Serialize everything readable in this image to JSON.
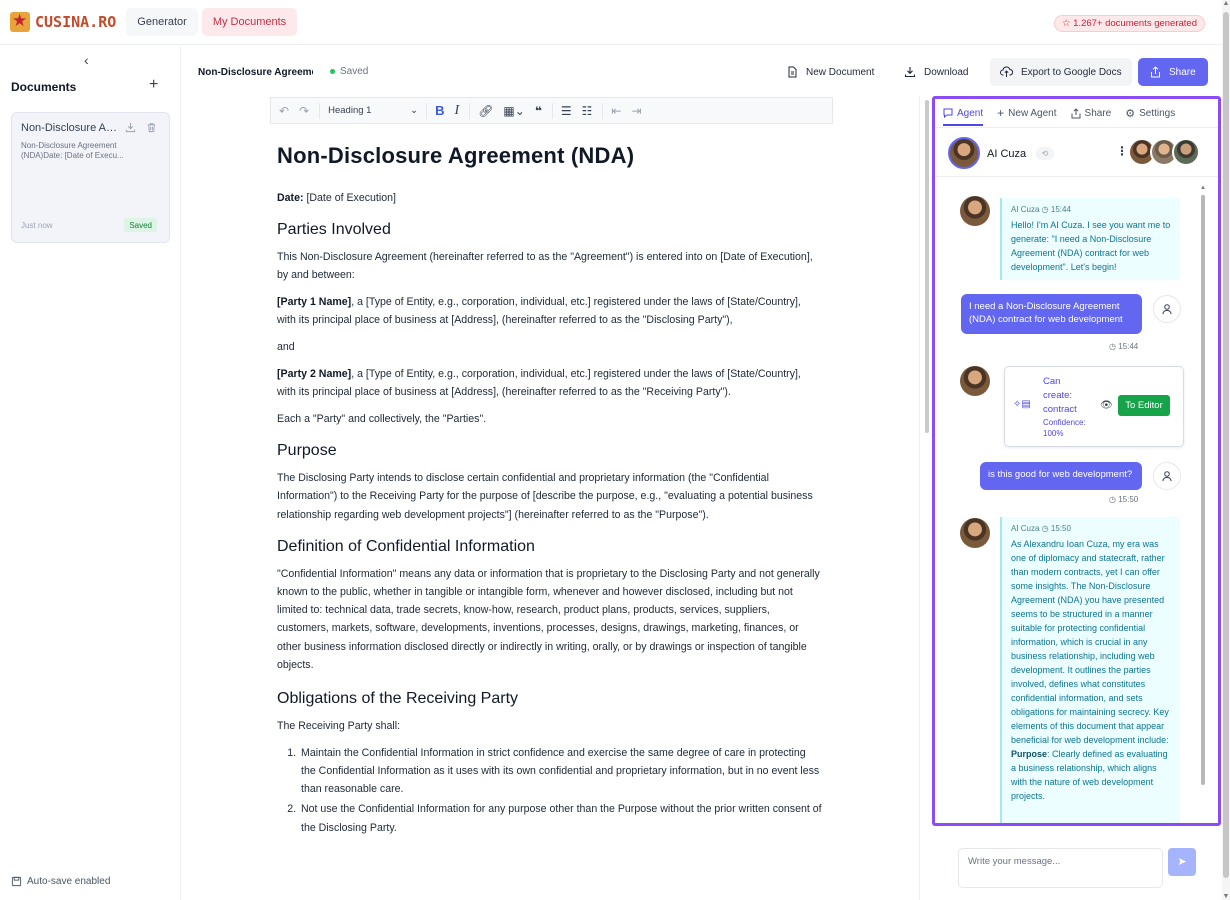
{
  "app": {
    "logo_text": "CUSINA.RO",
    "nav": [
      {
        "label": "Generator"
      },
      {
        "label": "My Documents"
      }
    ],
    "doc_count_badge": "☆ 1.267+ documents generated",
    "accent_color": "#6366f1",
    "agent_border_color": "#8b4cf7"
  },
  "sidebar": {
    "collapse_icon": "chevron-left-icon",
    "title": "Documents",
    "add_icon": "plus-icon",
    "documents": [
      {
        "title": "Non-Disclosure Agreement (NDA)",
        "subtitle": "Non-Disclosure Agreement (NDA)Date: [Date of Execu...",
        "time": "Just now",
        "status": "Saved"
      }
    ],
    "autosave_label": "Auto-save enabled"
  },
  "doc_toolbar": {
    "document_name": "Non-Disclosure Agreement (NDA)",
    "status": "Saved",
    "new_document": "New Document",
    "download": "Download",
    "export": "Export to Google Docs",
    "share": "Share"
  },
  "editor_toolbar": {
    "heading_select": "Heading 1"
  },
  "document": {
    "title": "Non-Disclosure Agreement (NDA)",
    "date_label": "Date:",
    "date_value": " [Date of Execution]",
    "section1": "Parties Involved",
    "p1": "This Non-Disclosure Agreement (hereinafter referred to as the \"Agreement\") is entered into on [Date of Execution], by and between:",
    "party1_name": "[Party 1 Name]",
    "party1_rest": ", a [Type of Entity, e.g., corporation, individual, etc.] registered under the laws of [State/Country], with its principal place of business at [Address], (hereinafter referred to as the \"Disclosing Party\"),",
    "and": "and",
    "party2_name": "[Party 2 Name]",
    "party2_rest": ", a [Type of Entity, e.g., corporation, individual, etc.] registered under the laws of [State/Country], with its principal place of business at [Address], (hereinafter referred to as the \"Receiving Party\").",
    "parties_note": "Each a \"Party\" and collectively, the \"Parties\".",
    "section2": "Purpose",
    "purpose": "The Disclosing Party intends to disclose certain confidential and proprietary information (the \"Confidential Information\") to the Receiving Party for the purpose of [describe the purpose, e.g., \"evaluating a potential business relationship regarding web development projects\"] (hereinafter referred to as the \"Purpose\").",
    "section3": "Definition of Confidential Information",
    "definition": "\"Confidential Information\" means any data or information that is proprietary to the Disclosing Party and not generally known to the public, whether in tangible or intangible form, whenever and however disclosed, including but not limited to: technical data, trade secrets, know-how, research, product plans, products, services, suppliers, customers, markets, software, developments, inventions, processes, designs, drawings, marketing, finances, or other business information disclosed directly or indirectly in writing, orally, or by drawings or inspection of tangible objects.",
    "section4": "Obligations of the Receiving Party",
    "obligations_intro": "The Receiving Party shall:",
    "obligations": [
      "Maintain the Confidential Information in strict confidence and exercise the same degree of care in protecting the Confidential Information as it uses with its own confidential and proprietary information, but in no event less than reasonable care.",
      "Not use the Confidential Information for any purpose other than the Purpose without the prior written consent of the Disclosing Party."
    ]
  },
  "agent": {
    "tabs": [
      {
        "label": "Agent",
        "icon": "chat-icon"
      },
      {
        "label": "New Agent",
        "icon": "plus-icon"
      },
      {
        "label": "Share",
        "icon": "share-icon"
      },
      {
        "label": "Settings",
        "icon": "gear-icon"
      }
    ],
    "name": "AI Cuza",
    "history_icon": "history-icon",
    "messages": {
      "m1_meta": "AI Cuza ◷ 15:44",
      "m1_text": "Hello! I'm AI Cuza. I see you want me to generate: \"I need a Non-Disclosure Agreement (NDA) contract for web development\". Let's begin!",
      "u1_text": "I need a Non-Disclosure Agreement (NDA) contract for web development",
      "u1_time": "◷ 15:44",
      "card_line1": "Can",
      "card_line2": "create:",
      "card_line3": "contract",
      "card_confidence": "Confidence: 100%",
      "card_button": "To Editor",
      "u2_text": "is this good for web development?",
      "u2_time": "◷ 15:50",
      "m2_meta": "AI Cuza ◷ 15:50",
      "m2_text": "As Alexandru Ioan Cuza, my era was one of diplomacy and statecraft, rather than modern contracts, yet I can offer some insights. The Non-Disclosure Agreement (NDA) you have presented seems to be structured in a manner suitable for protecting confidential information, which is crucial in any business relationship, including web development. It outlines the parties involved, defines what constitutes confidential information, and sets obligations for maintaining secrecy. Key elements of this document that appear beneficial for web development include:",
      "m2_purpose_label": "Purpose",
      "m2_purpose_text": ": Clearly defined as evaluating a business relationship, which aligns with the nature of web development projects."
    },
    "input_placeholder": "Write your message..."
  }
}
